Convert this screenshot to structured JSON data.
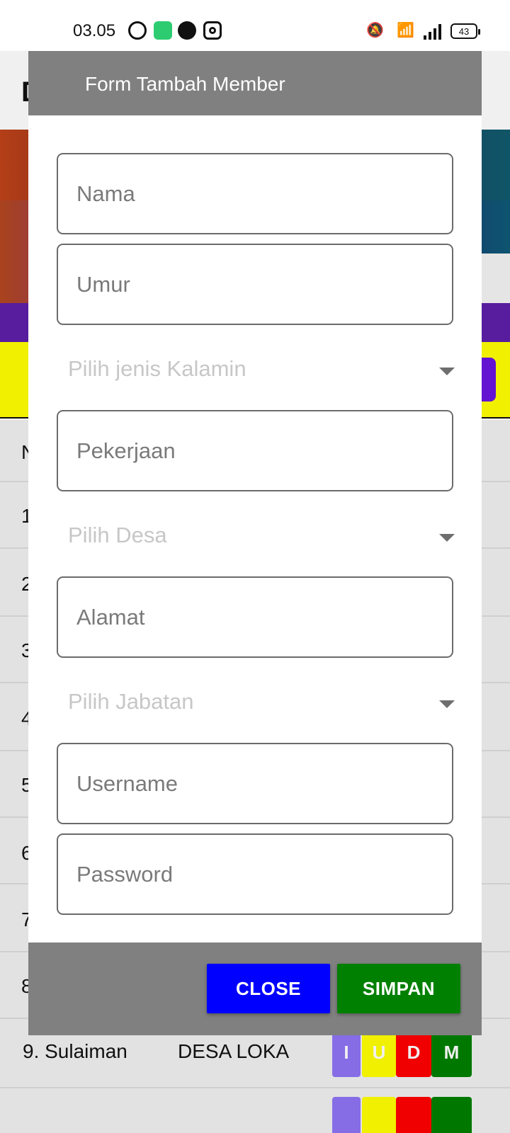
{
  "status_bar": {
    "time": "03.05",
    "battery": "43",
    "icons": [
      "whatsapp-icon",
      "battery-saver-icon",
      "nav-app-icon",
      "instagram-icon",
      "mute-icon",
      "wifi-icon",
      "signal-icon"
    ]
  },
  "background": {
    "visible_row_numbers": [
      "1",
      "2",
      "3",
      "4",
      "5",
      "6",
      "7",
      "8"
    ],
    "rows": [
      {
        "name": "9. Sulaiman",
        "desa": "DESA LOKA",
        "actions": [
          "I",
          "U",
          "D",
          "M"
        ]
      }
    ],
    "colors": {
      "banner_yellow": "#ffff00",
      "action_i": "#8f74f5",
      "action_u": "#ffff00",
      "action_d": "#ff0000",
      "action_m": "#008000"
    }
  },
  "modal": {
    "title": "Form Tambah Member",
    "fields": {
      "nama": "Nama",
      "umur": "Umur",
      "jenis_kelamin": "Pilih jenis Kalamin",
      "pekerjaan": "Pekerjaan",
      "desa": "Pilih Desa",
      "alamat": "Alamat",
      "jabatan": "Pilih Jabatan",
      "username": "Username",
      "password": "Password"
    },
    "buttons": {
      "close": "CLOSE",
      "save": "SIMPAN"
    },
    "colors": {
      "header": "#808080",
      "close_button": "#0000ff",
      "save_button": "#008000"
    }
  }
}
